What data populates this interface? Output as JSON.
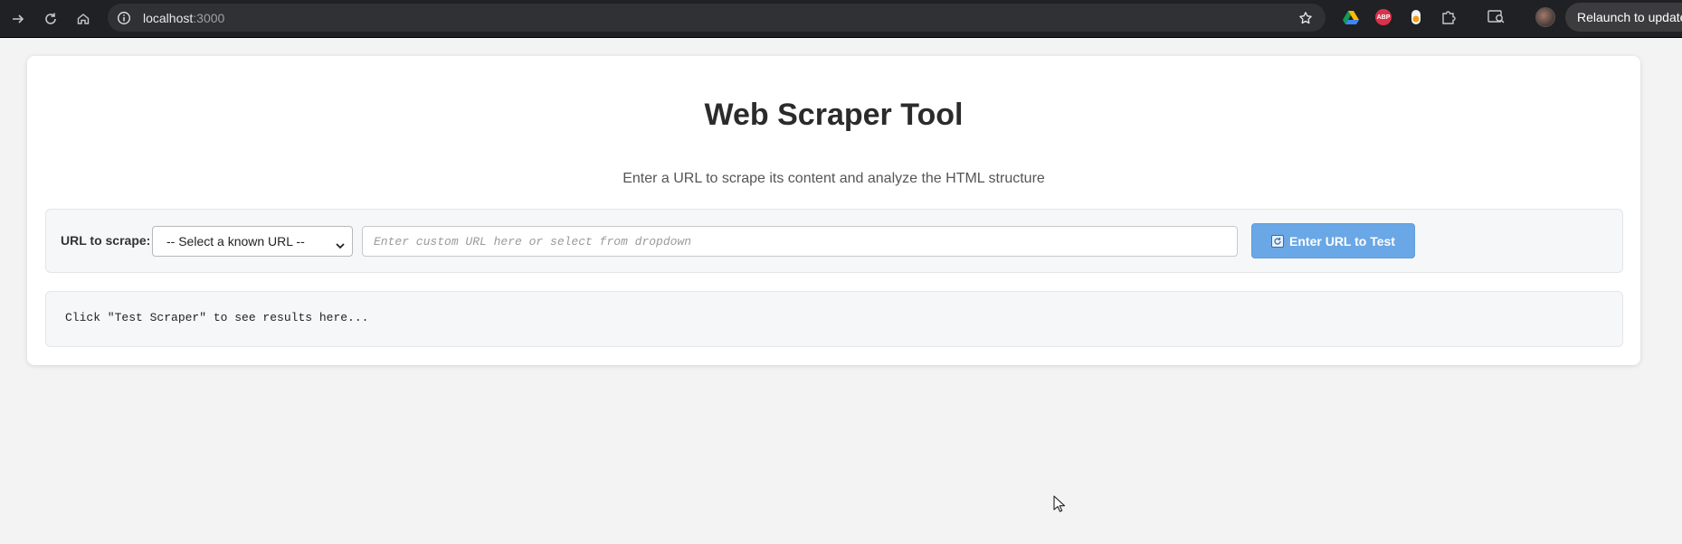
{
  "browser": {
    "url_host": "localhost",
    "url_port": ":3000",
    "relaunch_label": "Relaunch to update",
    "extensions": [
      "google-drive-icon",
      "adblock-plus-icon",
      "extension-orange-icon",
      "puzzle-icon"
    ],
    "abp_badge": "ABP"
  },
  "page": {
    "title": "Web Scraper Tool",
    "subtitle": "Enter a URL to scrape its content and analyze the HTML structure",
    "form": {
      "label": "URL to scrape:",
      "select_value": "-- Select a known URL --",
      "input_placeholder": "Enter custom URL here or select from dropdown",
      "button_label": "Enter URL to Test"
    },
    "results_text": "Click \"Test Scraper\" to see results here..."
  },
  "colors": {
    "button": "#6aa7e6",
    "chrome_bg": "#202124"
  }
}
